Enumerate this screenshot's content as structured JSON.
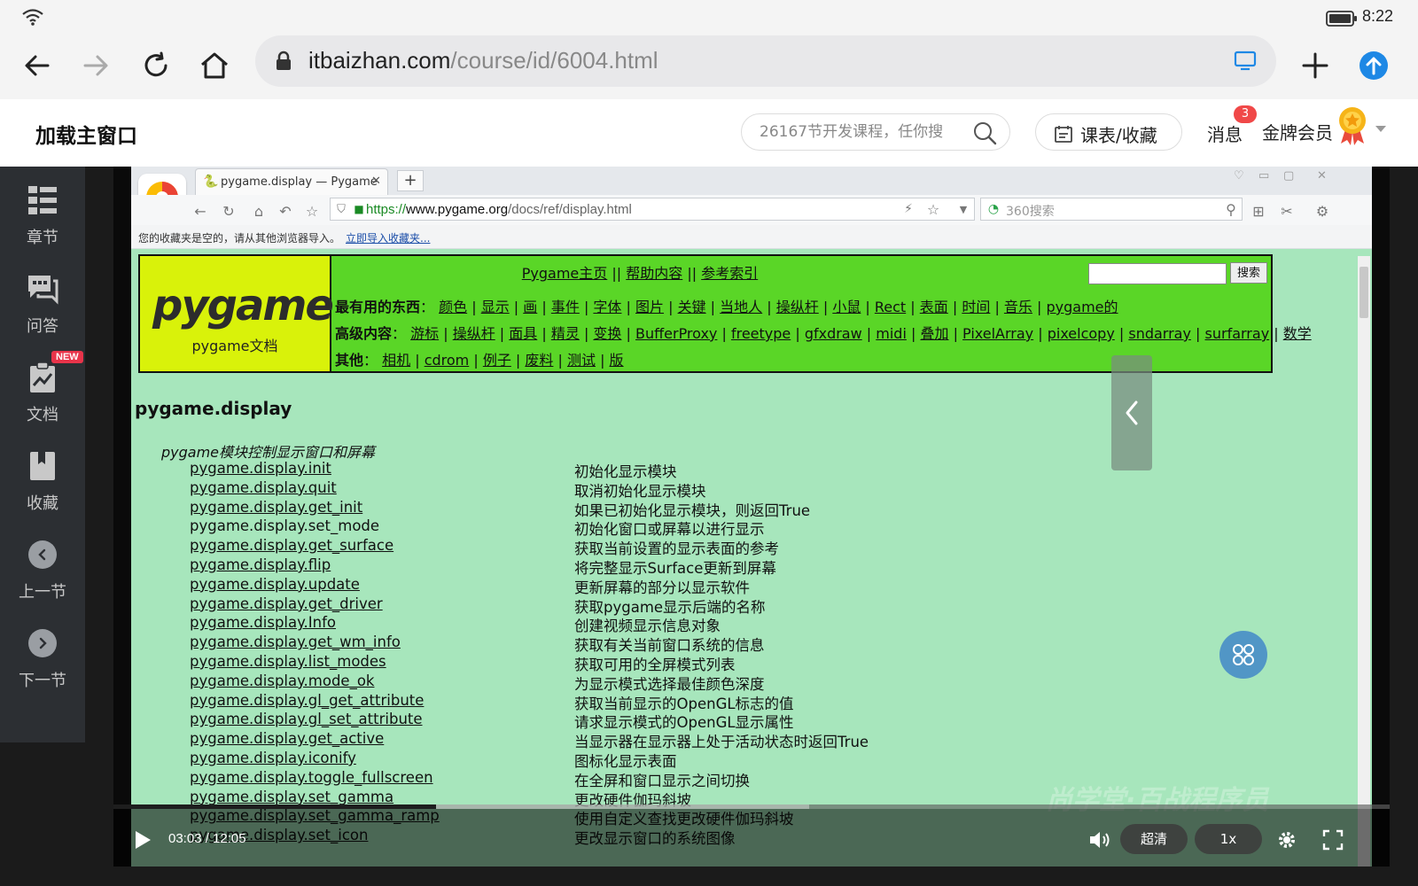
{
  "status": {
    "time": "8:22"
  },
  "browser": {
    "url_host": "itbaizhan.com",
    "url_path": "/course/id/6004.html"
  },
  "site": {
    "title": "加载主窗口",
    "search_placeholder": "26167节开发课程，任你搜",
    "schedule_label": "课表/收藏",
    "messages_label": "消息",
    "messages_count": "3",
    "vip_label": "金牌会员"
  },
  "sidebar": {
    "new_badge": "NEW",
    "items": [
      {
        "label": "章节",
        "icon": "chapters-icon"
      },
      {
        "label": "问答",
        "icon": "qa-icon"
      },
      {
        "label": "文档",
        "icon": "document-icon"
      },
      {
        "label": "收藏",
        "icon": "bookmark-icon"
      },
      {
        "label": "上一节",
        "icon": "previous-icon"
      },
      {
        "label": "下一节",
        "icon": "next-icon"
      }
    ]
  },
  "inner_browser": {
    "tab_title": "pygame.display — Pygame",
    "url_scheme": "https://",
    "url_host": "www.pygame.org",
    "url_path": "/docs/ref/display.html",
    "search_placeholder": "360搜索",
    "fav_empty": "您的收藏夹是空的，请从其他浏览器导入。",
    "fav_import": "立即导入收藏夹..."
  },
  "pygame_page": {
    "logo_text": "pygame",
    "logo_sub": "pygame文档",
    "top_links": [
      "Pygame主页",
      "帮助内容",
      "参考索引"
    ],
    "search_button": "搜索",
    "row1_label": "最有用的东西",
    "row1_links": [
      "颜色",
      "显示",
      "画",
      "事件",
      "字体",
      "图片",
      "关键",
      "当地人",
      "操纵杆",
      "小鼠",
      "Rect",
      "表面",
      "时间",
      "音乐",
      "pygame的"
    ],
    "row2_label": "高级内容",
    "row2_links": [
      "游标",
      "操纵杆",
      "面具",
      "精灵",
      "变换",
      "BufferProxy",
      "freetype",
      "gfxdraw",
      "midi",
      "叠加",
      "PixelArray",
      "pixelcopy",
      "sndarray",
      "surfarray",
      "数学"
    ],
    "row3_label": "其他",
    "row3_links": [
      "相机",
      "cdrom",
      "例子",
      "废料",
      "测试",
      "版"
    ],
    "module_title": "pygame.display",
    "module_desc": "pygame模块控制显示窗口和屏幕",
    "functions": [
      {
        "name": "pygame.display.init",
        "desc": "初始化显示模块"
      },
      {
        "name": "pygame.display.quit",
        "desc": "取消初始化显示模块"
      },
      {
        "name": "pygame.display.get_init",
        "desc": "如果已初始化显示模块，则返回True"
      },
      {
        "name": "pygame.display.set_mode",
        "desc": "初始化窗口或屏幕以进行显示"
      },
      {
        "name": "pygame.display.get_surface",
        "desc": "获取当前设置的显示表面的参考"
      },
      {
        "name": "pygame.display.flip",
        "desc": "将完整显示Surface更新到屏幕"
      },
      {
        "name": "pygame.display.update",
        "desc": "更新屏幕的部分以显示软件"
      },
      {
        "name": "pygame.display.get_driver",
        "desc": "获取pygame显示后端的名称"
      },
      {
        "name": "pygame.display.Info",
        "desc": "创建视频显示信息对象"
      },
      {
        "name": "pygame.display.get_wm_info",
        "desc": "获取有关当前窗口系统的信息"
      },
      {
        "name": "pygame.display.list_modes",
        "desc": "获取可用的全屏模式列表"
      },
      {
        "name": "pygame.display.mode_ok",
        "desc": "为显示模式选择最佳颜色深度"
      },
      {
        "name": "pygame.display.gl_get_attribute",
        "desc": "获取当前显示的OpenGL标志的值"
      },
      {
        "name": "pygame.display.gl_set_attribute",
        "desc": "请求显示模式的OpenGL显示属性"
      },
      {
        "name": "pygame.display.get_active",
        "desc": "当显示器在显示器上处于活动状态时返回True"
      },
      {
        "name": "pygame.display.iconify",
        "desc": "图标化显示表面"
      },
      {
        "name": "pygame.display.toggle_fullscreen",
        "desc": "在全屏和窗口显示之间切换"
      },
      {
        "name": "pygame.display.set_gamma",
        "desc": "更改硬件伽玛斜坡"
      },
      {
        "name": "pygame.display.set_gamma_ramp",
        "desc": "使用自定义查找更改硬件伽玛斜坡"
      },
      {
        "name": "pygame.display.set_icon",
        "desc": "更改显示窗口的系统图像"
      }
    ]
  },
  "player": {
    "time": "03:03 / 12:05",
    "progress": 0.253,
    "buffered": 0.545,
    "quality": "超清",
    "speed": "1x",
    "watermark": "尚学堂·百战程序员"
  }
}
